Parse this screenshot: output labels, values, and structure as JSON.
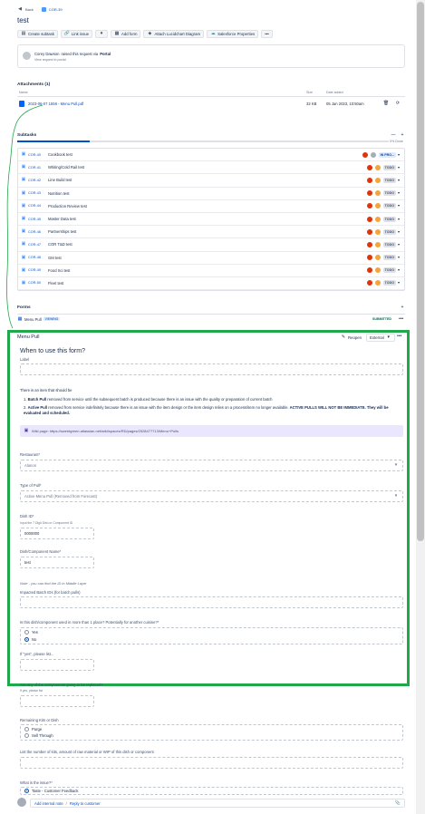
{
  "nav": {
    "back": "Back",
    "issue_key": "COR-39"
  },
  "title": "test",
  "toolbar": {
    "create_subtask": "Create subtask",
    "link_issue": "Link issue",
    "add_form": "Add form",
    "lucidchart": "Attach Lucidchart Diagram",
    "salesforce": "Salesforce Properties",
    "more": "•••"
  },
  "raised": {
    "name": "Corey Dawson",
    "text": "raised this request via",
    "channel": "Portal",
    "link": "View request in portal"
  },
  "attachments": {
    "header": "Attachments (1)",
    "col_name": "Name",
    "col_size": "Size",
    "col_date": "Date added",
    "file": "2023-06-07 1558 - Menu Pull.pdf",
    "size": "32 KB",
    "date": "05 Jan 2023, 10:50am"
  },
  "subtasks": {
    "header": "Subtasks",
    "progress": "0% Done",
    "items": [
      {
        "key": "COR-40",
        "name": "Cookbook test",
        "status": "IN PRO..."
      },
      {
        "key": "COR-41",
        "name": "Whiting/Cold Rail test",
        "status": "TODO"
      },
      {
        "key": "COR-42",
        "name": "Line Build test",
        "status": "TODO"
      },
      {
        "key": "COR-43",
        "name": "Nutrition test",
        "status": "TODO"
      },
      {
        "key": "COR-44",
        "name": "Production Review test",
        "status": "TODO"
      },
      {
        "key": "COR-45",
        "name": "Master Data test",
        "status": "TODO"
      },
      {
        "key": "COR-46",
        "name": "Partnerships test",
        "status": "TODO"
      },
      {
        "key": "COR-47",
        "name": "COR T&D test",
        "status": "TODO"
      },
      {
        "key": "COR-48",
        "name": "GM test",
        "status": "TODO"
      },
      {
        "key": "COR-49",
        "name": "Food Sci test",
        "status": "TODO"
      },
      {
        "key": "COR-50",
        "name": "Fleet test",
        "status": "TODO"
      }
    ]
  },
  "forms": {
    "header": "Forms",
    "name": "Menu Pull",
    "badge": "VIEWING",
    "status": "SUBMITTED",
    "more": "•••"
  },
  "form": {
    "title": "Menu Pull",
    "reopen": "Reopen",
    "visibility": "External",
    "heading": "When to use this form?",
    "label": "Label",
    "intro": "There is an item that should be",
    "item1_bold": "Batch Pull",
    "item1_text": " removed from service until the subsequent batch is produced because there is an issue with the quality or preparation of current batch",
    "item2_bold": "Active Pull",
    "item2_text": " removed from service indefinitely because there is an issue with the item design or the item design relies on a process/item no longer available.",
    "item2_caps": " ACTIVE PULLS WILL NOT BE IMMEDIATE. They will be evaluated and scheduled.",
    "wiki": "Wiki page: https://sweetgreen.atlassian.net/wiki/spaces/RD/pages/2528477713/Menu+Pulls",
    "restaurant_label": "Restaurant*",
    "restaurant_value": "Alanon",
    "type_label": "Type of Pull*",
    "type_value": "Active Menu Pull (Removed from Forecast)",
    "dish_label": "Dish ID*",
    "dish_help": "Input the 7 Digit Dish or Component ID",
    "dish_value": "0000000",
    "name_label": "Dish/Component Name*",
    "name_value": "test",
    "note": "Note - you can find the ID in Middle Layer",
    "batch_label": "Impacted Batch IDs (for batch pulls)",
    "multi_label": "Is this dish/component used in more than 1 place? Potentially for another cuisine?*",
    "opt_yes": "Yes",
    "opt_no": "No",
    "ifyes_label": "If \"yes\", please list...",
    "replace_label": "Are any of the components going to be replaced?",
    "replace_help": "If yes, please list",
    "remaining_label": "Remaining Kits or Dish",
    "opt_purge": "Purge",
    "opt_sell": "Sell Through",
    "kits_label": "List the number of kits, amount of raw material or WIP of this dish or component",
    "issue_label": "What is the issue?*",
    "issue_value": "Taste - Customer Feedback"
  },
  "comment": {
    "internal": "Add internal note",
    "sep": "/",
    "reply": "Reply to customer"
  },
  "colors": {
    "highlight": "#21a84a",
    "accent": "#0052cc"
  }
}
